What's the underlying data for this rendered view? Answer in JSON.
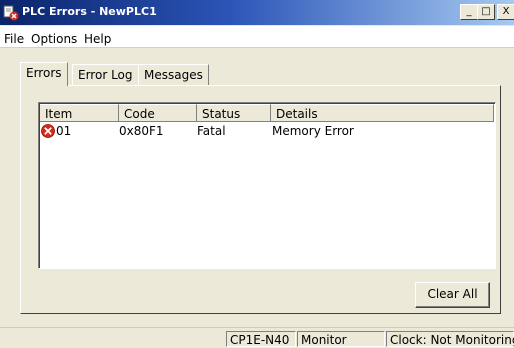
{
  "window": {
    "title": "PLC Errors - NewPLC1",
    "controls": {
      "minimize": "_",
      "maximize": "□",
      "close": "X"
    }
  },
  "menu": {
    "items": [
      "File",
      "Options",
      "Help"
    ]
  },
  "tabs": [
    {
      "label": "Errors",
      "active": true
    },
    {
      "label": "Error Log",
      "active": false
    },
    {
      "label": "Messages",
      "active": false
    }
  ],
  "table": {
    "columns": [
      "Item",
      "Code",
      "Status",
      "Details"
    ],
    "rows": [
      {
        "icon": "error-icon",
        "item": "01",
        "code": "0x80F1",
        "status": "Fatal",
        "details": "Memory Error"
      }
    ]
  },
  "buttons": {
    "clear_all": "Clear All"
  },
  "status_bar": {
    "model": "CP1E-N40",
    "mode": "Monitor",
    "clock": "Clock: Not Monitoring"
  },
  "colors": {
    "title_bar_start": "#0a246a",
    "title_bar_end": "#a6caf0",
    "error_icon": "#d42a1c"
  }
}
